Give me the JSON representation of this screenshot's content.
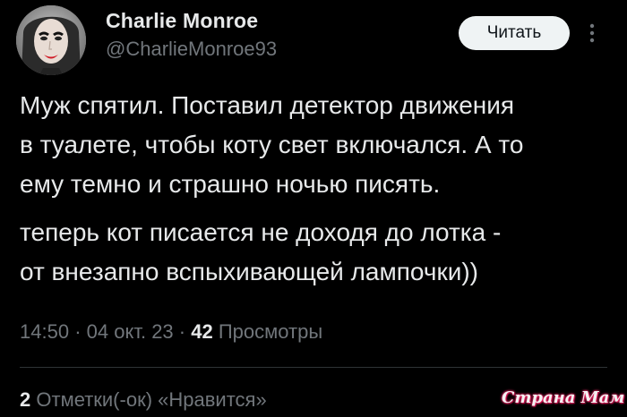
{
  "author": {
    "name": "Charlie Monroe",
    "handle": "@CharlieMonroe93"
  },
  "follow_button": "Читать",
  "tweet": {
    "paragraphs": [
      {
        "lines": [
          "Муж спятил. Поставил детектор движения",
          "в туалете, чтобы коту свет включался. А то",
          "ему темно и страшно ночью писять."
        ]
      },
      {
        "lines": [
          "теперь кот писается не доходя до лотка -",
          "от внезапно вспыхивающей лампочки))"
        ]
      }
    ]
  },
  "meta": {
    "time": "14:50",
    "separator": "·",
    "date": "04 окт. 23",
    "views_count": "42",
    "views_label": "Просмотры"
  },
  "stats": {
    "likes_count": "2",
    "likes_label": "Отметки(-ок) «Нравится»"
  },
  "watermark": "Страна Мам",
  "icons": {
    "more": "more-vertical-icon"
  },
  "colors": {
    "background": "#000000",
    "primary_text": "#e7e9ea",
    "secondary_text": "#71767b",
    "button_bg": "#eff3f4"
  }
}
